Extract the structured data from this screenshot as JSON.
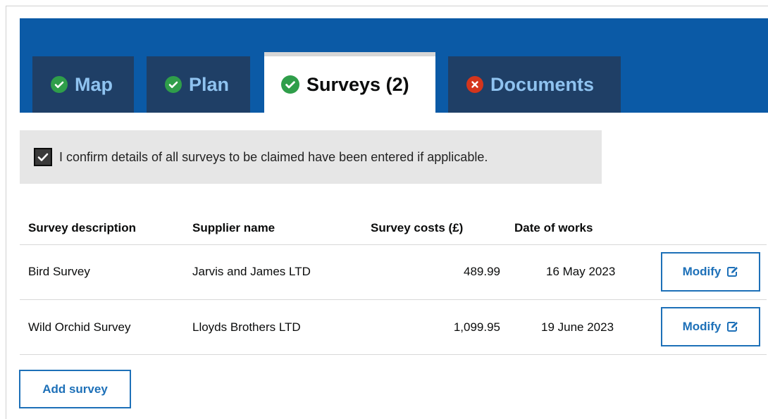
{
  "tabs": {
    "map": {
      "label": "Map",
      "status": "complete"
    },
    "plan": {
      "label": "Plan",
      "status": "complete"
    },
    "surveys": {
      "label": "Surveys (2)",
      "status": "complete"
    },
    "documents": {
      "label": "Documents",
      "status": "error"
    }
  },
  "confirm": {
    "checked": true,
    "text": "I confirm details of all surveys to be claimed have been entered if applicable."
  },
  "table": {
    "headers": {
      "description": "Survey description",
      "supplier": "Supplier name",
      "costs": "Survey costs (£)",
      "date": "Date of works"
    },
    "rows": [
      {
        "description": "Bird Survey",
        "supplier": "Jarvis and James LTD",
        "costs": "489.99",
        "date": "16 May 2023",
        "action": "Modify"
      },
      {
        "description": "Wild Orchid Survey",
        "supplier": "Lloyds Brothers LTD",
        "costs": "1,099.95",
        "date": "19 June 2023",
        "action": "Modify"
      }
    ]
  },
  "add_button": "Add survey",
  "colors": {
    "tab_band": "#0b5aa6",
    "tab_inactive": "#1f3f66",
    "tab_text": "#8fc3f0",
    "success": "#2f9e4a",
    "error": "#d4351c",
    "link": "#1d70b8"
  },
  "icons": {
    "complete": "check-circle-icon",
    "error": "cross-circle-icon",
    "edit": "edit-icon"
  }
}
